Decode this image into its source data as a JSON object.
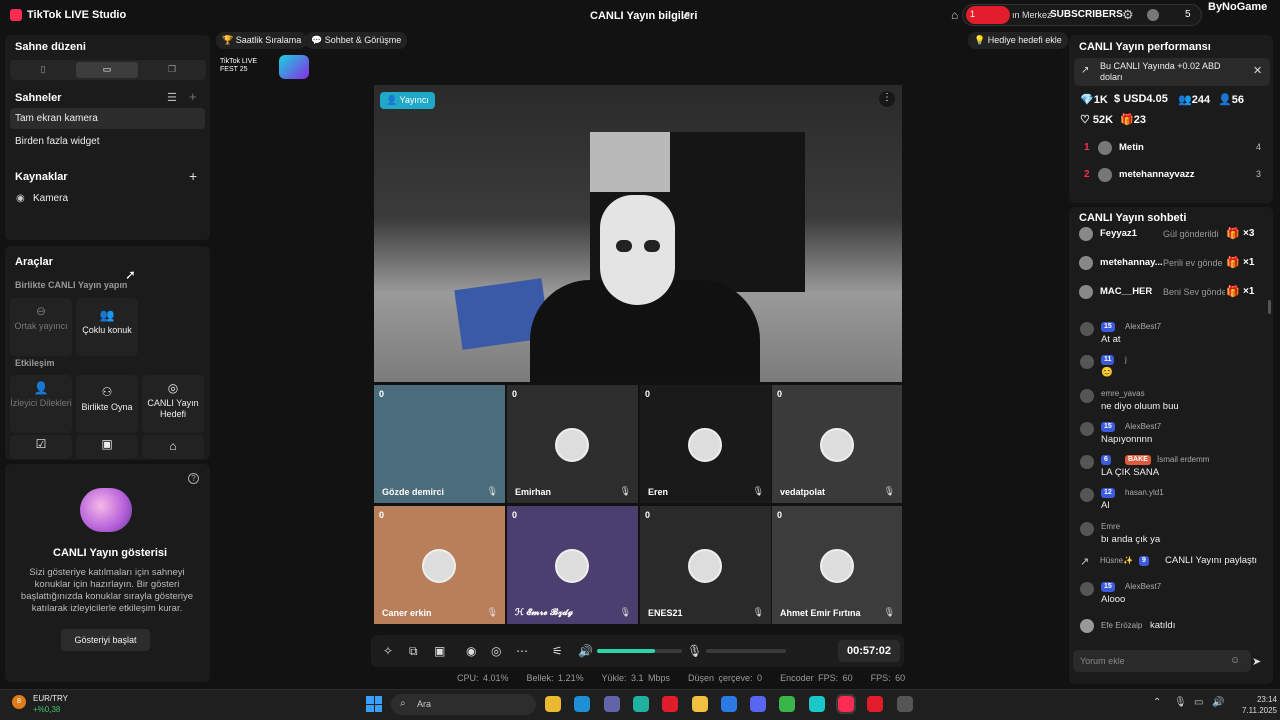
{
  "titlebar": {
    "app_title": "TikTok LIVE Studio",
    "live_info": "CANLI Yayın bilgileri",
    "overlay_badge": "1",
    "overlay_text": "ın Merkez",
    "overlay_subscribers": "SUBSCRIBERS",
    "overlay_count": "5",
    "brand": "ByNoGame"
  },
  "left": {
    "scene_layout_title": "Sahne düzeni",
    "scenes_title": "Sahneler",
    "scenes": [
      "Tam ekran kamera",
      "Birden fazla widget"
    ],
    "sources_title": "Kaynaklar",
    "sources": [
      "Kamera"
    ],
    "tools_title": "Araçlar",
    "collab_title": "Birlikte CANLI Yayın yapın",
    "collab_tools": [
      {
        "label": "Ortak yayıncı",
        "icon": "link-icon"
      },
      {
        "label": "Çoklu konuk",
        "icon": "multi-guest-icon"
      }
    ],
    "interaction_title": "Etkileşim",
    "interaction_tools": [
      {
        "label": "İzleyici Dilekleri",
        "icon": "wishes-icon"
      },
      {
        "label": "Birlikte Oyna",
        "icon": "play-together-icon"
      },
      {
        "label": "CANLI Yayın Hedefi",
        "icon": "goal-icon"
      }
    ],
    "show_title": "CANLI Yayın gösterisi",
    "show_desc": "Sizi gösteriye katılmaları için sahneyi konuklar için hazırlayın. Bir gösteri başlattığınızda konuklar sırayla gösteriye katılarak izleyicilerle etkileşim kurar.",
    "show_button": "Gösteriyi başlat"
  },
  "topstrip": {
    "hourly_rank": "Saatlik Sıralama",
    "chat_call": "Sohbet & Görüşme",
    "gift_goal": "Hediye hedefi ekle",
    "fest_logo": "TikTok LIVE FEST 25"
  },
  "stage": {
    "host_badge": "Yayıncı",
    "guests": [
      {
        "name": "Gözde demirci",
        "count": "0"
      },
      {
        "name": "Emirhan",
        "count": "0"
      },
      {
        "name": "Eren",
        "count": "0"
      },
      {
        "name": "vedatpolat",
        "count": "0"
      },
      {
        "name": "Caner erkin",
        "count": "0"
      },
      {
        "name": "ℋ 𝓔𝓶𝓻𝓮 𝓑𝔃𝓭𝓰",
        "count": "0"
      },
      {
        "name": "ENES21",
        "count": "0"
      },
      {
        "name": "Ahmet Emir Fırtına",
        "count": "0"
      }
    ]
  },
  "controls": {
    "timer": "00:57:02",
    "volume_level": 0.68
  },
  "stats": {
    "cpu": "CPU: 4.01%",
    "memory": "Bellek: 1.21%",
    "upload": "Yükle: 3.1 Mbps",
    "dropped": "Düşen çerçeve: 0",
    "encoder_fps": "Encoder FPS: 60",
    "fps": "FPS: 60"
  },
  "right": {
    "perf_title": "CANLI Yayın performansı",
    "perf_note": "Bu CANLI Yayında +0.02 ABD doları",
    "stats": [
      "1K",
      "USD4.05",
      "244",
      "56",
      "52K",
      "23"
    ],
    "ranking": [
      {
        "rank": "1",
        "name": "Metin",
        "value": "4"
      },
      {
        "rank": "2",
        "name": "metehannayvazz",
        "value": "3"
      }
    ],
    "chat_title": "CANLI Yayın sohbeti",
    "gifts": [
      {
        "name": "Feyyaz1",
        "text": "Gül gönderildi",
        "count": "×3"
      },
      {
        "name": "metehannay...",
        "text": "Perili ev gönde",
        "count": "×1"
      },
      {
        "name": "MAC__HER",
        "text": "Beni Sev gönderil",
        "count": "×1"
      }
    ],
    "messages": [
      {
        "level": "15",
        "user": "AlexBest7",
        "msg": "At at"
      },
      {
        "level": "11",
        "user": "j",
        "msg": "😊"
      },
      {
        "level": "",
        "user": "emre_yavas",
        "msg": "ne diyo oluum buu"
      },
      {
        "level": "15",
        "user": "AlexBest7",
        "msg": "Napıyonnnn"
      },
      {
        "level": "6",
        "user": "İsmail erdemm",
        "msg": "LA ÇIK SANA",
        "tag": "BAKE"
      },
      {
        "level": "12",
        "user": "hasan.yld1",
        "msg": "Al"
      },
      {
        "level": "",
        "user": "Emre",
        "msg": "bı anda çık ya"
      },
      {
        "level": "15",
        "user": "AlexBest7",
        "msg": "Alooo"
      }
    ],
    "share_event": {
      "user": "Hüsne✨",
      "level": "9",
      "text": "CANLI Yayını paylaştı"
    },
    "join_event": {
      "user": "Efe Erözalp",
      "text": "katıldı"
    },
    "comment_placeholder": "Yorum ekle"
  },
  "taskbar": {
    "ticker_name": "EUR/TRY",
    "ticker_value": "+%0,38",
    "ticker_badge": "8",
    "search_placeholder": "Ara",
    "time": "23:14",
    "date": "7.11.2025"
  },
  "colors": {
    "accent": "#fe2c55",
    "teal": "#20a8c9",
    "volume": "#2dd4a8"
  }
}
